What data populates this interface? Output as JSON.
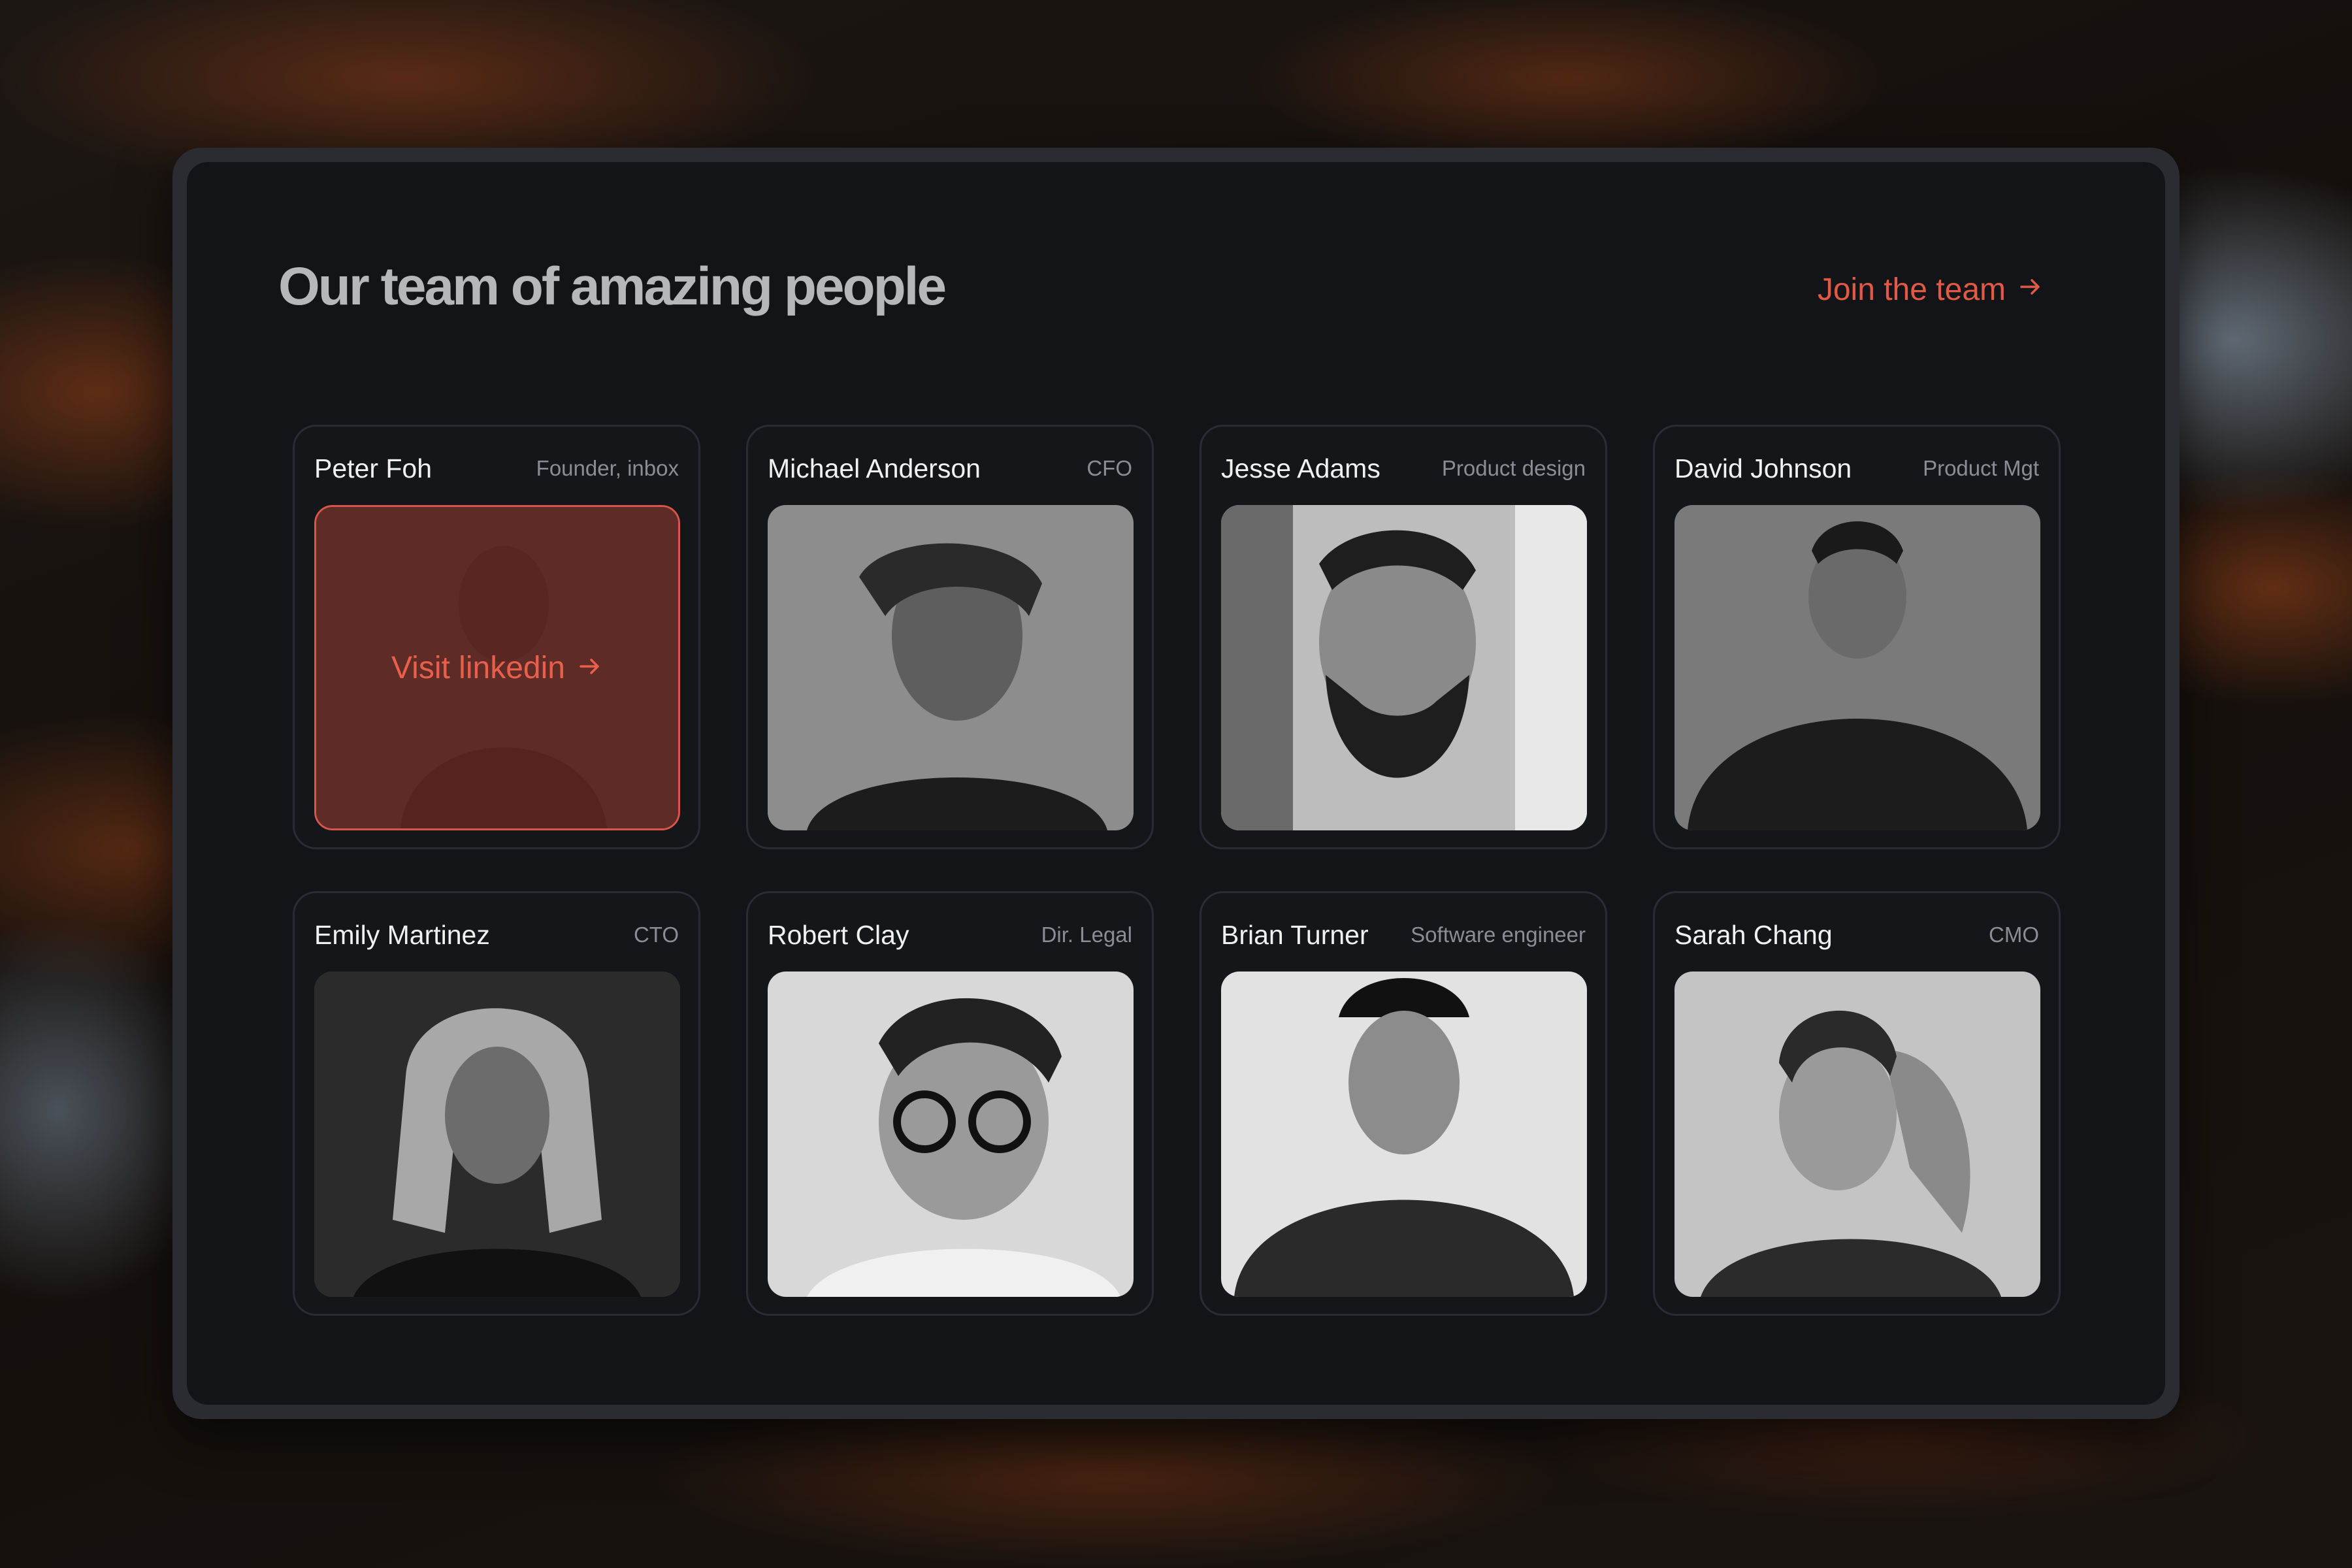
{
  "section": {
    "title": "Our team of amazing people",
    "join_label": "Join the team",
    "join_icon": "arrow-right-icon"
  },
  "colors": {
    "accent": "#e05a45",
    "panel": "#131417",
    "card_border": "#2a2c31",
    "name": "#f1f1f2",
    "role": "#8b8d92"
  },
  "hover_overlay": {
    "label": "Visit linkedin",
    "icon": "arrow-right-icon"
  },
  "team": [
    {
      "name": "Peter Foh",
      "role": "Founder, inbox",
      "photo": "portrait-photo",
      "active": true
    },
    {
      "name": "Michael Anderson",
      "role": "CFO",
      "photo": "portrait-photo",
      "active": false
    },
    {
      "name": "Jesse Adams",
      "role": "Product design",
      "photo": "portrait-photo",
      "active": false
    },
    {
      "name": "David Johnson",
      "role": "Product Mgt",
      "photo": "portrait-photo",
      "active": false
    },
    {
      "name": "Emily Martinez",
      "role": "CTO",
      "photo": "portrait-photo",
      "active": false
    },
    {
      "name": "Robert Clay",
      "role": "Dir. Legal",
      "photo": "portrait-photo",
      "active": false
    },
    {
      "name": "Brian Turner",
      "role": "Software engineer",
      "photo": "portrait-photo",
      "active": false
    },
    {
      "name": "Sarah Chang",
      "role": "CMO",
      "photo": "portrait-photo",
      "active": false
    }
  ]
}
